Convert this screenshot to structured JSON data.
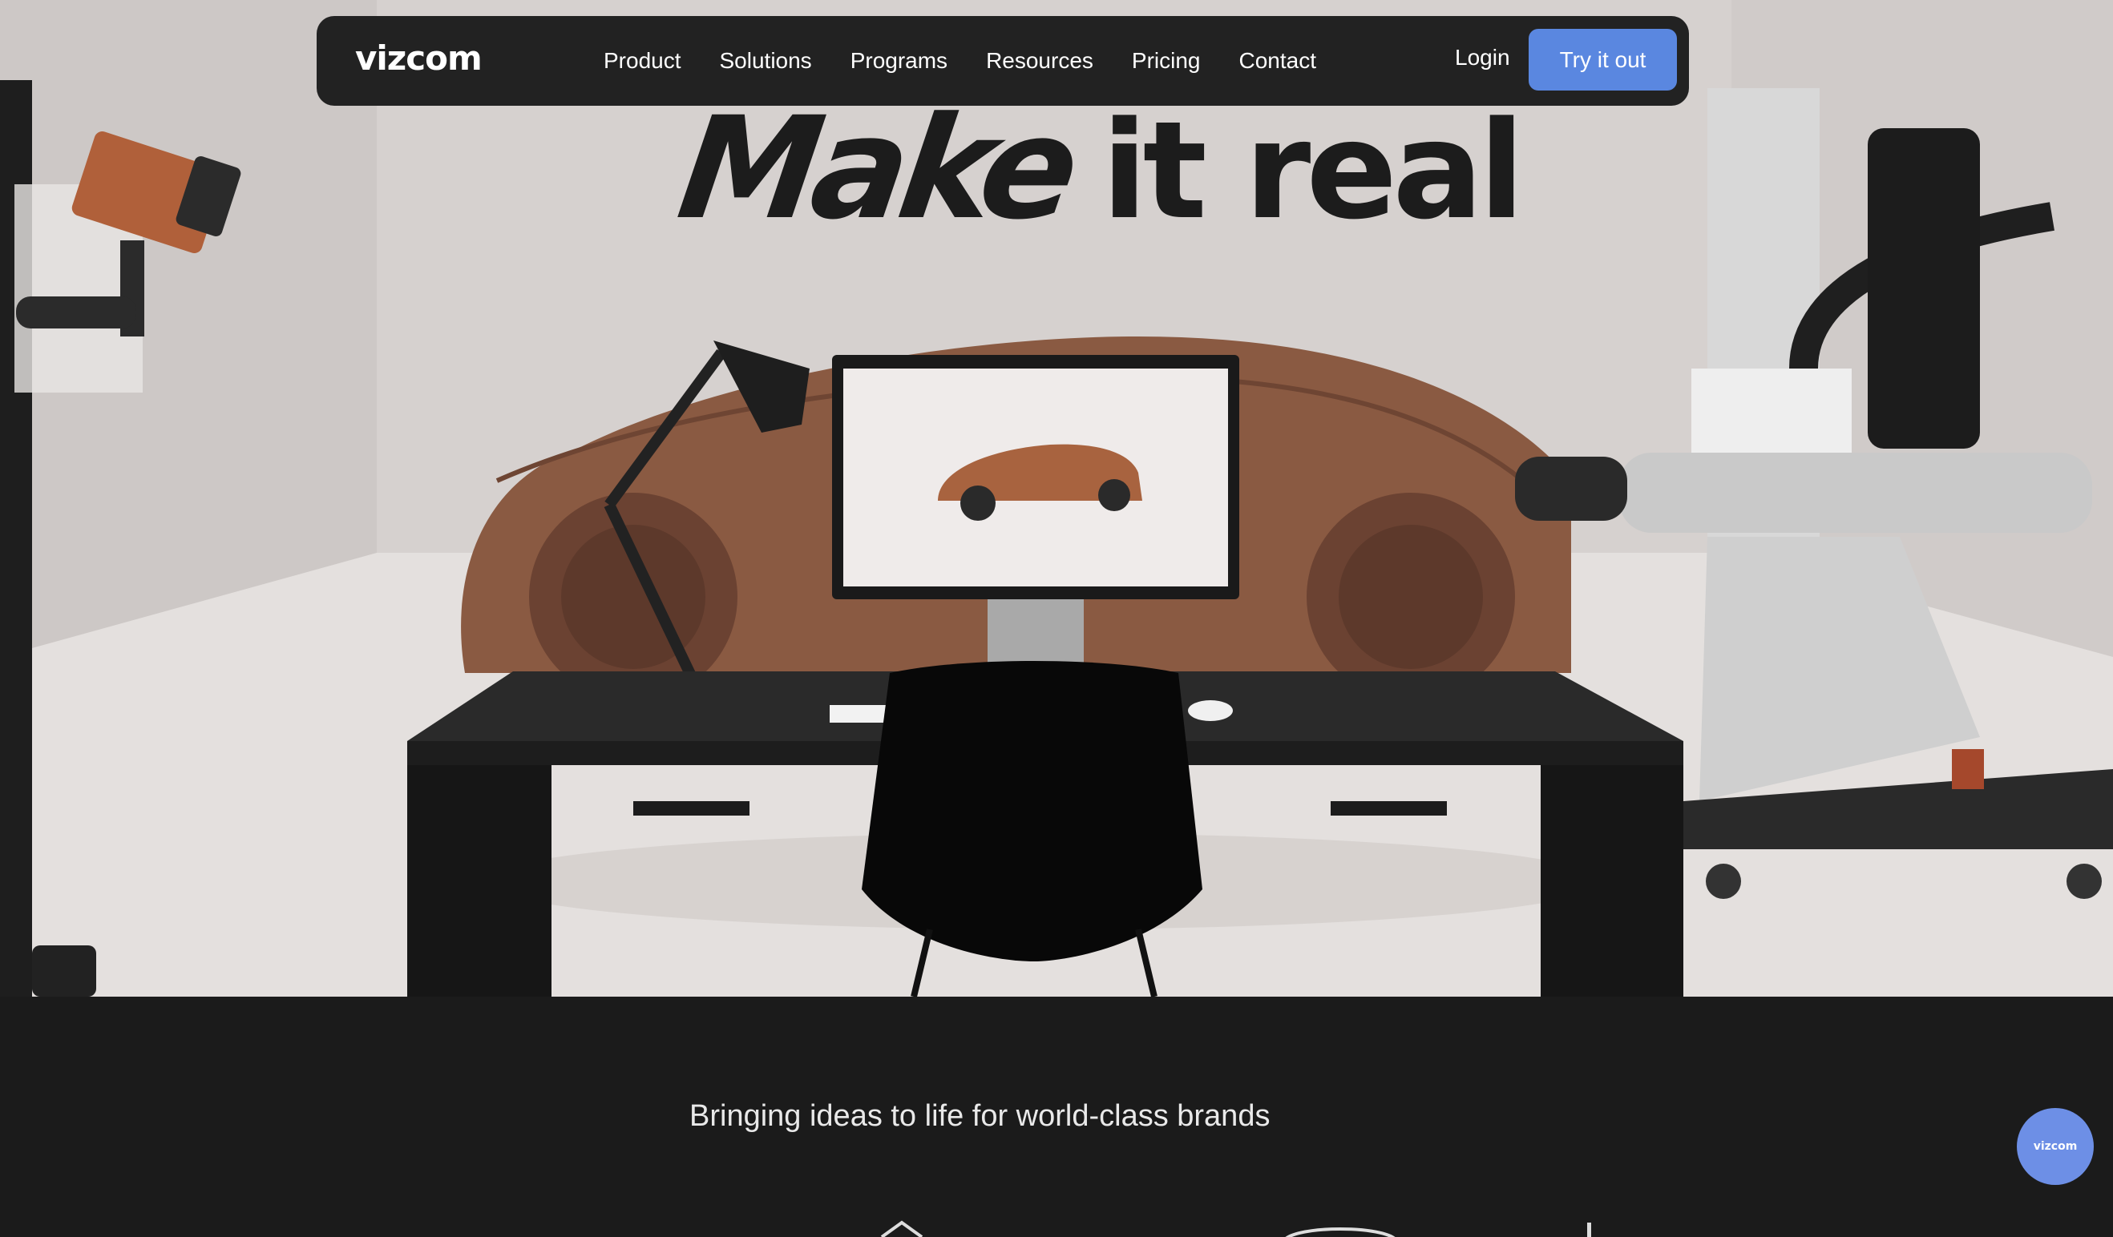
{
  "brand": {
    "logo_text": "vizcom"
  },
  "nav": {
    "links": [
      "Product",
      "Solutions",
      "Programs",
      "Resources",
      "Pricing",
      "Contact"
    ],
    "login_label": "Login",
    "cta_label": "Try it out"
  },
  "hero": {
    "headline_part1": "Make",
    "headline_part2": "it real"
  },
  "brands_section": {
    "heading": "Bringing ideas to life for world-class brands"
  },
  "chat_widget": {
    "label": "vizcom"
  },
  "colors": {
    "nav_bg": "#222222",
    "cta": "#5a87e0",
    "chat": "#6d8fe6",
    "page_bg": "#1b1b1b",
    "clay": "#8a5a42"
  },
  "icons": [
    "vizcom-logo",
    "chat-widget-icon"
  ]
}
